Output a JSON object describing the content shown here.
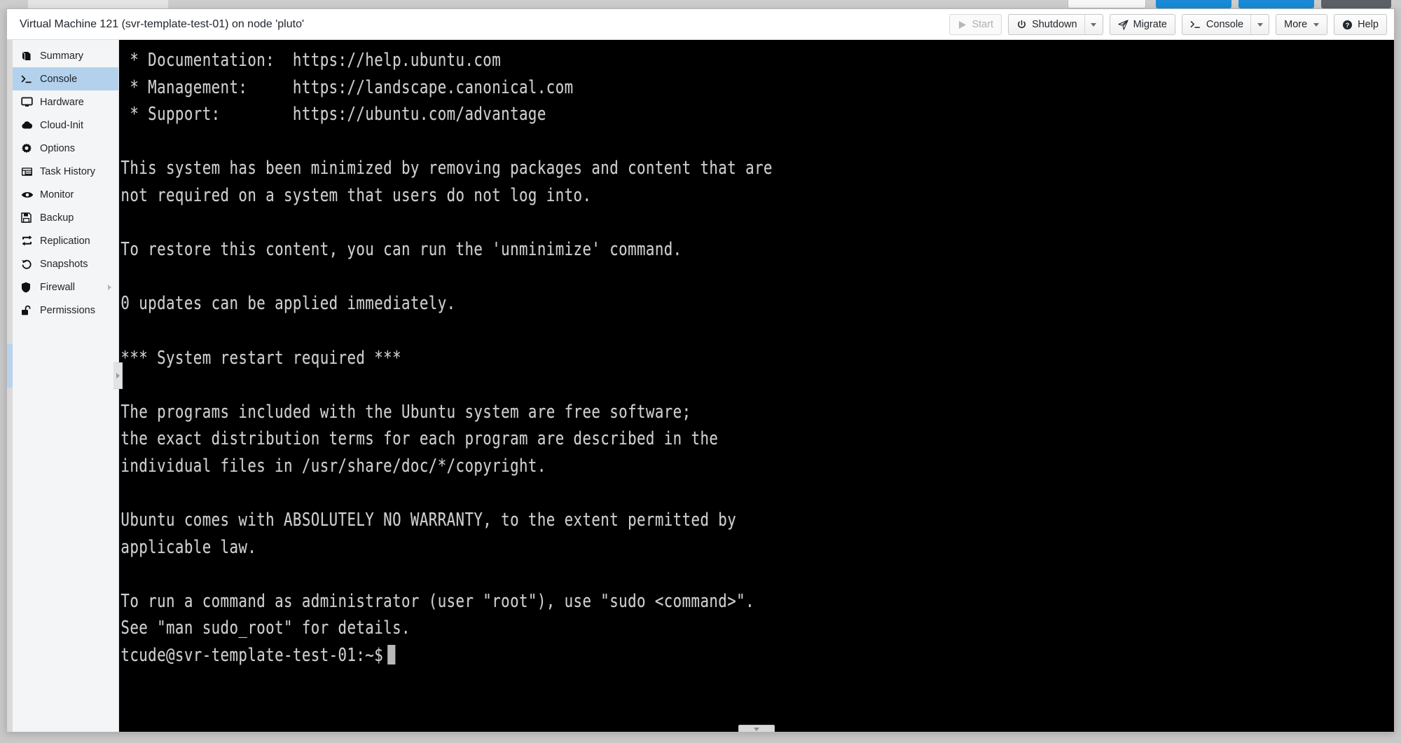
{
  "window": {
    "title": "Virtual Machine 121 (svr-template-test-01) on node 'pluto'"
  },
  "toolbar": {
    "start": {
      "label": "Start",
      "icon": "play-icon",
      "disabled": true
    },
    "shutdown": {
      "label": "Shutdown",
      "icon": "power-icon",
      "has_dropdown": true
    },
    "migrate": {
      "label": "Migrate",
      "icon": "paper-plane-icon",
      "has_dropdown": false
    },
    "console": {
      "label": "Console",
      "icon": "terminal-prompt-icon",
      "has_dropdown": true
    },
    "more": {
      "label": "More",
      "icon": "",
      "has_dropdown": true
    },
    "help": {
      "label": "Help",
      "icon": "question-circle-icon",
      "has_dropdown": false
    }
  },
  "sidebar": {
    "items": [
      {
        "label": "Summary",
        "icon": "book-icon",
        "active": false,
        "submenu": false
      },
      {
        "label": "Console",
        "icon": "terminal-icon",
        "active": true,
        "submenu": false
      },
      {
        "label": "Hardware",
        "icon": "monitor-icon",
        "active": false,
        "submenu": false
      },
      {
        "label": "Cloud-Init",
        "icon": "cloud-icon",
        "active": false,
        "submenu": false
      },
      {
        "label": "Options",
        "icon": "gear-icon",
        "active": false,
        "submenu": false
      },
      {
        "label": "Task History",
        "icon": "list-window-icon",
        "active": false,
        "submenu": false
      },
      {
        "label": "Monitor",
        "icon": "eye-icon",
        "active": false,
        "submenu": false
      },
      {
        "label": "Backup",
        "icon": "floppy-disk-icon",
        "active": false,
        "submenu": false
      },
      {
        "label": "Replication",
        "icon": "sync-arrows-icon",
        "active": false,
        "submenu": false
      },
      {
        "label": "Snapshots",
        "icon": "history-icon",
        "active": false,
        "submenu": false
      },
      {
        "label": "Firewall",
        "icon": "shield-icon",
        "active": false,
        "submenu": true
      },
      {
        "label": "Permissions",
        "icon": "unlock-icon",
        "active": false,
        "submenu": false
      }
    ]
  },
  "console": {
    "prompt": "tcude@svr-template-test-01:~$",
    "cursor_visible": true,
    "text": " * Documentation:  https://help.ubuntu.com\n * Management:     https://landscape.canonical.com\n * Support:        https://ubuntu.com/advantage\n\nThis system has been minimized by removing packages and content that are\nnot required on a system that users do not log into.\n\nTo restore this content, you can run the 'unminimize' command.\n\n0 updates can be applied immediately.\n\n*** System restart required ***\n\nThe programs included with the Ubuntu system are free software;\nthe exact distribution terms for each program are described in the\nindividual files in /usr/share/doc/*/copyright.\n\nUbuntu comes with ABSOLUTELY NO WARRANTY, to the extent permitted by\napplicable law.\n\nTo run a command as administrator (user \"root\"), use \"sudo <command>\".\nSee \"man sudo_root\" for details.\n"
  },
  "colors": {
    "active_nav": "#b3d1ed",
    "terminal_bg": "#000000",
    "terminal_fg": "#cfcfcf",
    "window_bg": "#ffffff",
    "desktop_bg": "#c8c8c8"
  }
}
